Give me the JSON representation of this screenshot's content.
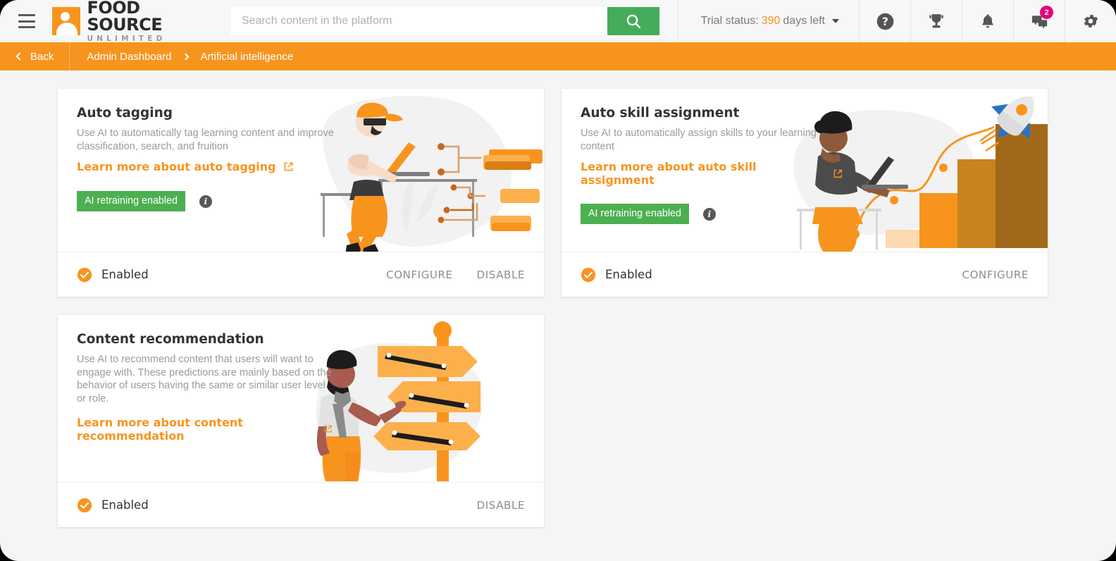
{
  "header": {
    "menu_icon": "hamburger-menu-icon",
    "logo": {
      "main": "FOOD SOURCE",
      "sub": "UNLIMITED"
    },
    "search": {
      "placeholder": "Search content in the platform",
      "value": "",
      "button_icon": "search-icon"
    },
    "trial": {
      "prefix": "Trial status:",
      "days": "390",
      "suffix": "days left"
    },
    "icons": [
      {
        "name": "help-icon",
        "glyph": "?"
      },
      {
        "name": "trophy-icon",
        "glyph": " "
      },
      {
        "name": "bell-icon",
        "glyph": " "
      },
      {
        "name": "messages-icon",
        "glyph": " ",
        "badge": "2"
      },
      {
        "name": "gear-icon",
        "glyph": " "
      }
    ],
    "badge_color": "#e6007e"
  },
  "breadcrumb": {
    "back_label": "Back",
    "items": [
      {
        "label": "Admin Dashboard"
      },
      {
        "label": "Artificial intelligence"
      }
    ]
  },
  "cards": [
    {
      "title": "Auto tagging",
      "description": "Use AI to automatically tag learning content and improve classification, search, and fruition",
      "learn_more": "Learn more about auto tagging",
      "pill": "AI retraining enabled",
      "pill_color": "#4caf50",
      "info_tooltip_icon": "info-icon",
      "status": "Enabled",
      "actions": [
        "CONFIGURE",
        "DISABLE"
      ],
      "illustration": "person-laptop-tagging-illustration"
    },
    {
      "title": "Auto skill assignment",
      "description": "Use AI to automatically assign skills to your learning content",
      "learn_more": "Learn more about auto skill assignment",
      "pill": "AI retraining enabled",
      "pill_color": "#4caf50",
      "info_tooltip_icon": "info-icon",
      "status": "Enabled",
      "actions": [
        "CONFIGURE"
      ],
      "illustration": "person-laptop-growth-chart-rocket-illustration"
    },
    {
      "title": "Content recommendation",
      "description": "Use AI to recommend content that users will want to engage with. These predictions are mainly based on the behavior of users having the same or similar user level or role.",
      "learn_more": "Learn more about content recommendation",
      "pill": null,
      "status": "Enabled",
      "actions": [
        "DISABLE"
      ],
      "illustration": "person-pointing-signpost-illustration"
    }
  ],
  "theme": {
    "accent": "#f7941e",
    "search_button": "#46ab5a",
    "page_bg": "#f5f5f5",
    "card_bg": "#ffffff"
  }
}
